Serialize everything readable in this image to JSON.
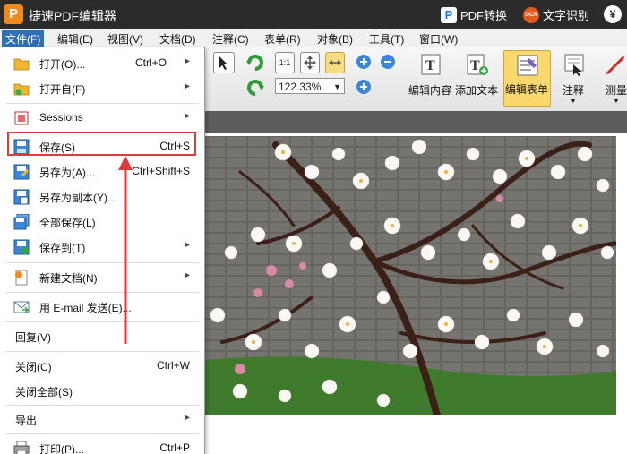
{
  "titlebar": {
    "logo_letter": "P",
    "app_title": "捷速PDF编辑器",
    "pdf_convert": "PDF转换",
    "ocr_badge": "OCR",
    "text_recognition": "文字识别",
    "yen": "¥"
  },
  "menubar": {
    "items": [
      "文件(F)",
      "编辑(E)",
      "视图(V)",
      "文档(D)",
      "注释(C)",
      "表单(R)",
      "对象(B)",
      "工具(T)",
      "窗口(W)"
    ]
  },
  "toolbar": {
    "zoom_value": "122.33%",
    "edit_content": "编辑内容",
    "add_text": "添加文本",
    "edit_form": "编辑表单",
    "annotate": "注释",
    "measure": "测量",
    "fit_label": "1:1"
  },
  "filemenu": {
    "items": [
      {
        "label": "打开(O)...",
        "shortcut": "Ctrl+O",
        "submenu": true
      },
      {
        "label": "打开自(F)",
        "shortcut": "",
        "submenu": true
      },
      {
        "label": "Sessions",
        "shortcut": "",
        "submenu": true
      },
      {
        "label": "保存(S)",
        "shortcut": "Ctrl+S",
        "submenu": false
      },
      {
        "label": "另存为(A)...",
        "shortcut": "Ctrl+Shift+S",
        "submenu": false
      },
      {
        "label": "另存为副本(Y)...",
        "shortcut": "",
        "submenu": false
      },
      {
        "label": "全部保存(L)",
        "shortcut": "",
        "submenu": false
      },
      {
        "label": "保存到(T)",
        "shortcut": "",
        "submenu": true
      },
      {
        "label": "新建文档(N)",
        "shortcut": "",
        "submenu": true
      },
      {
        "label": "用 E-mail 发送(E)...",
        "shortcut": "",
        "submenu": false
      },
      {
        "label": "回复(V)",
        "shortcut": "",
        "submenu": false
      },
      {
        "label": "关闭(C)",
        "shortcut": "Ctrl+W",
        "submenu": false
      },
      {
        "label": "关闭全部(S)",
        "shortcut": "",
        "submenu": false
      },
      {
        "label": "导出",
        "shortcut": "",
        "submenu": true
      },
      {
        "label": "打印(P)...",
        "shortcut": "Ctrl+P",
        "submenu": false
      }
    ],
    "submenu_glyph": "▸"
  },
  "colors": {
    "highlight": "#e03b3b",
    "active_tool": "#f9d86e",
    "menu_active": "#2f6fb3",
    "titlebar": "#2b2b2b"
  }
}
